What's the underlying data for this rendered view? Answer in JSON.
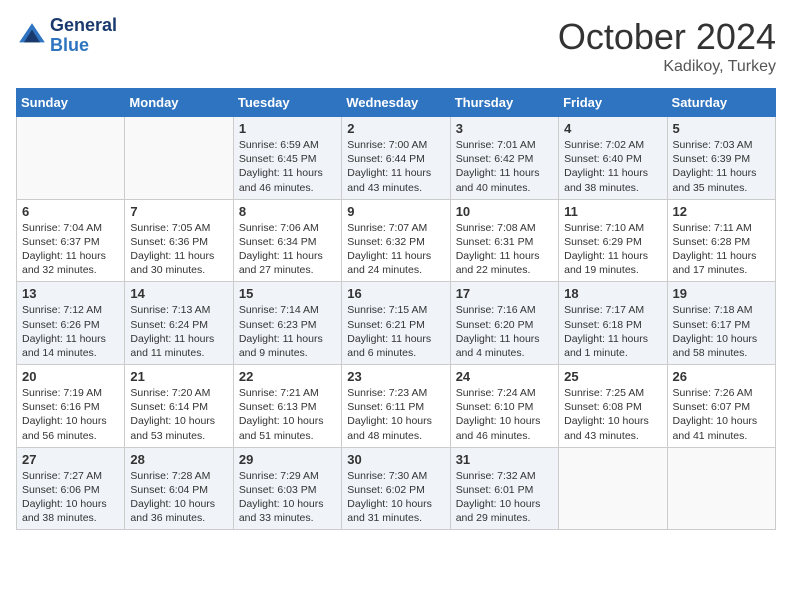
{
  "logo": {
    "line1": "General",
    "line2": "Blue"
  },
  "title": "October 2024",
  "location": "Kadikoy, Turkey",
  "days_of_week": [
    "Sunday",
    "Monday",
    "Tuesday",
    "Wednesday",
    "Thursday",
    "Friday",
    "Saturday"
  ],
  "weeks": [
    [
      {
        "day": "",
        "sunrise": "",
        "sunset": "",
        "daylight": ""
      },
      {
        "day": "",
        "sunrise": "",
        "sunset": "",
        "daylight": ""
      },
      {
        "day": "1",
        "sunrise": "Sunrise: 6:59 AM",
        "sunset": "Sunset: 6:45 PM",
        "daylight": "Daylight: 11 hours and 46 minutes."
      },
      {
        "day": "2",
        "sunrise": "Sunrise: 7:00 AM",
        "sunset": "Sunset: 6:44 PM",
        "daylight": "Daylight: 11 hours and 43 minutes."
      },
      {
        "day": "3",
        "sunrise": "Sunrise: 7:01 AM",
        "sunset": "Sunset: 6:42 PM",
        "daylight": "Daylight: 11 hours and 40 minutes."
      },
      {
        "day": "4",
        "sunrise": "Sunrise: 7:02 AM",
        "sunset": "Sunset: 6:40 PM",
        "daylight": "Daylight: 11 hours and 38 minutes."
      },
      {
        "day": "5",
        "sunrise": "Sunrise: 7:03 AM",
        "sunset": "Sunset: 6:39 PM",
        "daylight": "Daylight: 11 hours and 35 minutes."
      }
    ],
    [
      {
        "day": "6",
        "sunrise": "Sunrise: 7:04 AM",
        "sunset": "Sunset: 6:37 PM",
        "daylight": "Daylight: 11 hours and 32 minutes."
      },
      {
        "day": "7",
        "sunrise": "Sunrise: 7:05 AM",
        "sunset": "Sunset: 6:36 PM",
        "daylight": "Daylight: 11 hours and 30 minutes."
      },
      {
        "day": "8",
        "sunrise": "Sunrise: 7:06 AM",
        "sunset": "Sunset: 6:34 PM",
        "daylight": "Daylight: 11 hours and 27 minutes."
      },
      {
        "day": "9",
        "sunrise": "Sunrise: 7:07 AM",
        "sunset": "Sunset: 6:32 PM",
        "daylight": "Daylight: 11 hours and 24 minutes."
      },
      {
        "day": "10",
        "sunrise": "Sunrise: 7:08 AM",
        "sunset": "Sunset: 6:31 PM",
        "daylight": "Daylight: 11 hours and 22 minutes."
      },
      {
        "day": "11",
        "sunrise": "Sunrise: 7:10 AM",
        "sunset": "Sunset: 6:29 PM",
        "daylight": "Daylight: 11 hours and 19 minutes."
      },
      {
        "day": "12",
        "sunrise": "Sunrise: 7:11 AM",
        "sunset": "Sunset: 6:28 PM",
        "daylight": "Daylight: 11 hours and 17 minutes."
      }
    ],
    [
      {
        "day": "13",
        "sunrise": "Sunrise: 7:12 AM",
        "sunset": "Sunset: 6:26 PM",
        "daylight": "Daylight: 11 hours and 14 minutes."
      },
      {
        "day": "14",
        "sunrise": "Sunrise: 7:13 AM",
        "sunset": "Sunset: 6:24 PM",
        "daylight": "Daylight: 11 hours and 11 minutes."
      },
      {
        "day": "15",
        "sunrise": "Sunrise: 7:14 AM",
        "sunset": "Sunset: 6:23 PM",
        "daylight": "Daylight: 11 hours and 9 minutes."
      },
      {
        "day": "16",
        "sunrise": "Sunrise: 7:15 AM",
        "sunset": "Sunset: 6:21 PM",
        "daylight": "Daylight: 11 hours and 6 minutes."
      },
      {
        "day": "17",
        "sunrise": "Sunrise: 7:16 AM",
        "sunset": "Sunset: 6:20 PM",
        "daylight": "Daylight: 11 hours and 4 minutes."
      },
      {
        "day": "18",
        "sunrise": "Sunrise: 7:17 AM",
        "sunset": "Sunset: 6:18 PM",
        "daylight": "Daylight: 11 hours and 1 minute."
      },
      {
        "day": "19",
        "sunrise": "Sunrise: 7:18 AM",
        "sunset": "Sunset: 6:17 PM",
        "daylight": "Daylight: 10 hours and 58 minutes."
      }
    ],
    [
      {
        "day": "20",
        "sunrise": "Sunrise: 7:19 AM",
        "sunset": "Sunset: 6:16 PM",
        "daylight": "Daylight: 10 hours and 56 minutes."
      },
      {
        "day": "21",
        "sunrise": "Sunrise: 7:20 AM",
        "sunset": "Sunset: 6:14 PM",
        "daylight": "Daylight: 10 hours and 53 minutes."
      },
      {
        "day": "22",
        "sunrise": "Sunrise: 7:21 AM",
        "sunset": "Sunset: 6:13 PM",
        "daylight": "Daylight: 10 hours and 51 minutes."
      },
      {
        "day": "23",
        "sunrise": "Sunrise: 7:23 AM",
        "sunset": "Sunset: 6:11 PM",
        "daylight": "Daylight: 10 hours and 48 minutes."
      },
      {
        "day": "24",
        "sunrise": "Sunrise: 7:24 AM",
        "sunset": "Sunset: 6:10 PM",
        "daylight": "Daylight: 10 hours and 46 minutes."
      },
      {
        "day": "25",
        "sunrise": "Sunrise: 7:25 AM",
        "sunset": "Sunset: 6:08 PM",
        "daylight": "Daylight: 10 hours and 43 minutes."
      },
      {
        "day": "26",
        "sunrise": "Sunrise: 7:26 AM",
        "sunset": "Sunset: 6:07 PM",
        "daylight": "Daylight: 10 hours and 41 minutes."
      }
    ],
    [
      {
        "day": "27",
        "sunrise": "Sunrise: 7:27 AM",
        "sunset": "Sunset: 6:06 PM",
        "daylight": "Daylight: 10 hours and 38 minutes."
      },
      {
        "day": "28",
        "sunrise": "Sunrise: 7:28 AM",
        "sunset": "Sunset: 6:04 PM",
        "daylight": "Daylight: 10 hours and 36 minutes."
      },
      {
        "day": "29",
        "sunrise": "Sunrise: 7:29 AM",
        "sunset": "Sunset: 6:03 PM",
        "daylight": "Daylight: 10 hours and 33 minutes."
      },
      {
        "day": "30",
        "sunrise": "Sunrise: 7:30 AM",
        "sunset": "Sunset: 6:02 PM",
        "daylight": "Daylight: 10 hours and 31 minutes."
      },
      {
        "day": "31",
        "sunrise": "Sunrise: 7:32 AM",
        "sunset": "Sunset: 6:01 PM",
        "daylight": "Daylight: 10 hours and 29 minutes."
      },
      {
        "day": "",
        "sunrise": "",
        "sunset": "",
        "daylight": ""
      },
      {
        "day": "",
        "sunrise": "",
        "sunset": "",
        "daylight": ""
      }
    ]
  ]
}
